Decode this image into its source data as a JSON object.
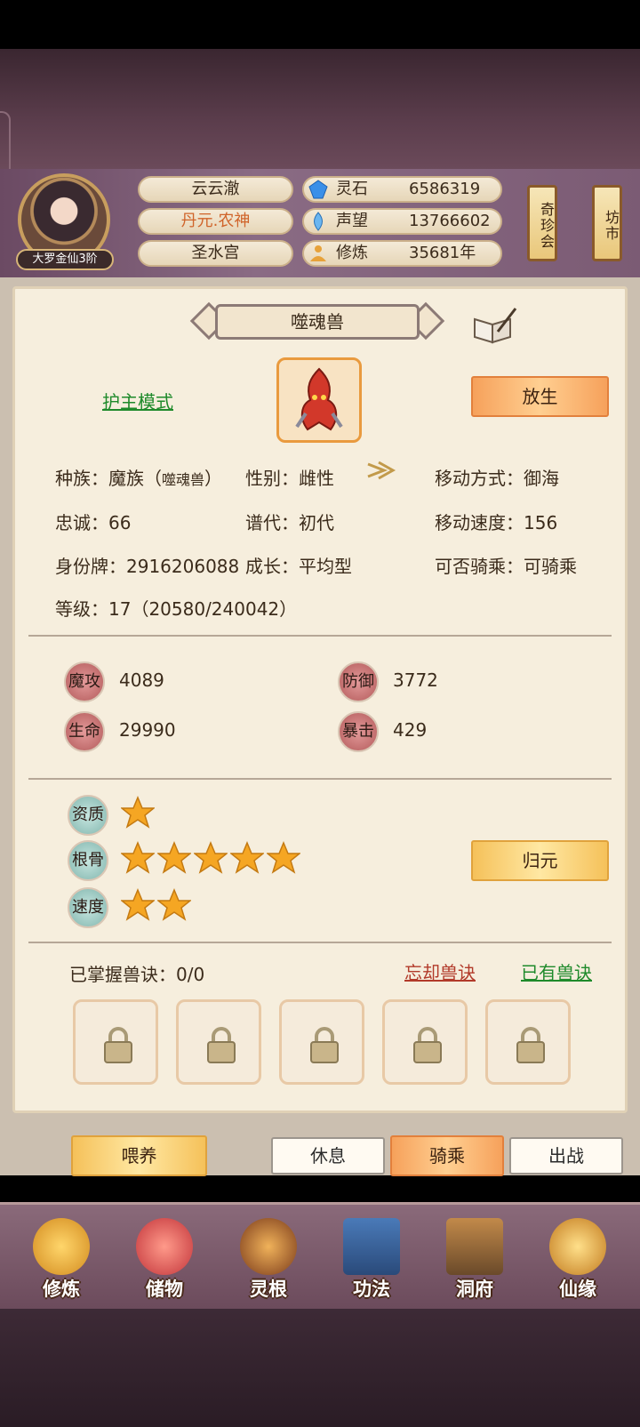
{
  "player": {
    "rank": "大罗金仙3阶",
    "name": "云云澈",
    "title": "丹元.农神",
    "sect": "圣水宫"
  },
  "resources": [
    {
      "icon": "spirit-stone-icon",
      "label": "灵石",
      "value": "6586319"
    },
    {
      "icon": "reputation-icon",
      "label": "声望",
      "value": "13766602"
    },
    {
      "icon": "cultivation-icon",
      "label": "修炼",
      "value": "35681年"
    }
  ],
  "side_buttons": {
    "treasure": "奇珍会",
    "market": "坊市"
  },
  "pet": {
    "name": "噬魂兽",
    "mode": "护主模式",
    "release": "放生",
    "race_label": "种族：魔族（",
    "race_sub": "噬魂兽",
    "race_close": "）",
    "gender": "性别：雌性",
    "move_type": "移动方式：御海",
    "loyalty": "忠诚：66",
    "generation": "谱代：初代",
    "move_speed": "移动速度：156",
    "id_tag": "身份牌：2916206088",
    "growth": "成长：平均型",
    "rideable": "可否骑乘：可骑乘",
    "level": "等级：17（20580/240042）"
  },
  "stats": [
    {
      "label": "魔攻",
      "value": "4089"
    },
    {
      "label": "防御",
      "value": "3772"
    },
    {
      "label": "生命",
      "value": "29990"
    },
    {
      "label": "暴击",
      "value": "429"
    }
  ],
  "talents": [
    {
      "label": "资质",
      "stars": 1
    },
    {
      "label": "根骨",
      "stars": 5
    },
    {
      "label": "速度",
      "stars": 2
    }
  ],
  "return_origin": "归元",
  "skills": {
    "mastered": "已掌握兽诀：0/0",
    "forget": "忘却兽诀",
    "owned": "已有兽诀"
  },
  "actions": {
    "feed": "喂养",
    "rest": "休息",
    "ride": "骑乘",
    "battle": "出战"
  },
  "nav": [
    "修炼",
    "储物",
    "灵根",
    "功法",
    "洞府",
    "仙缘"
  ]
}
